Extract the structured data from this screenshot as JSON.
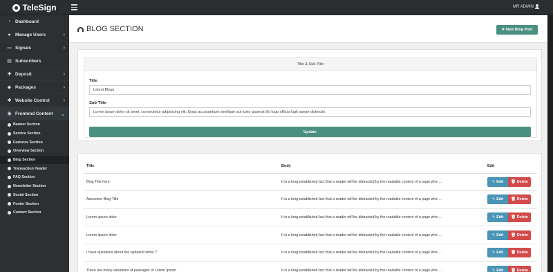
{
  "app": {
    "brand": "TeleSign",
    "user": "MR ADMIN"
  },
  "sidebar": {
    "items": [
      {
        "label": "Dashboard",
        "icon": "dashboard-icon",
        "chevron": false
      },
      {
        "label": "Manage Users",
        "icon": "users-icon",
        "chevron": true
      },
      {
        "label": "Signals",
        "icon": "monitor-icon",
        "chevron": true
      },
      {
        "label": "Subscribers",
        "icon": "document-icon",
        "chevron": false
      },
      {
        "label": "Deposit",
        "icon": "plus-icon",
        "chevron": true
      },
      {
        "label": "Packages",
        "icon": "packages-icon",
        "chevron": true
      },
      {
        "label": "Website Control",
        "icon": "gear-icon",
        "chevron": true
      },
      {
        "label": "Frontend Content",
        "icon": "globe-icon",
        "chevron": true,
        "open": true
      }
    ],
    "sub_items": [
      "Banner Section",
      "Service Section",
      "Features Section",
      "Overview Section",
      "Blog Section",
      "Transaction Header",
      "FAQ Section",
      "Newsletter Section",
      "Social Section",
      "Footer Section",
      "Contact Section"
    ],
    "active_sub": "Blog Section"
  },
  "page": {
    "title": "BLOG SECTION",
    "new_button": "New Blog Post"
  },
  "title_form": {
    "panel_heading": "Title & Sub-Title",
    "title_label": "Title",
    "title_value": "Latest Blogs",
    "subtitle_label": "Sub-Title",
    "subtitle_value": "Lorem ipsum dolor sit amet, consectetur adipisicing elit. Quas accusantium similique aut iusto quaerat illo fuga officia fugit saepe distinctio.",
    "update_button": "Update"
  },
  "table": {
    "headers": {
      "title": "Title",
      "body": "Body",
      "edit": "Edit"
    },
    "edit_label": "Edit",
    "delete_label": "Delete",
    "rows": [
      {
        "title": "Blog Title here",
        "body": "It is a long established fact that a reader will be distracted by the readable content of a page whe ..."
      },
      {
        "title": "Awesome Blog Title",
        "body": "It is a long established fact that a reader will be distracted by the readable content of a page whe ..."
      },
      {
        "title": "Lorem ipsum dolor",
        "body": "It is a long established fact that a reader will be distracted by the readable content of a page whe ..."
      },
      {
        "title": "Lorem ipsum dolor",
        "body": "It is a long established fact that a reader will be distracted by the readable content of a page whe ..."
      },
      {
        "title": "I have questions about the updated trems ?",
        "body": "It is a long established fact that a reader will be distracted by the readable content of a page whe ..."
      },
      {
        "title": "There are many variations of passages of Lorem Ipsum",
        "body": "It is a long established fact that a reader will be distracted by the readable content of a page whe ..."
      }
    ]
  },
  "colors": {
    "primary": "#4a9081",
    "edit": "#4a94b5",
    "delete": "#d24b4b",
    "sidebar": "#2c3033"
  }
}
